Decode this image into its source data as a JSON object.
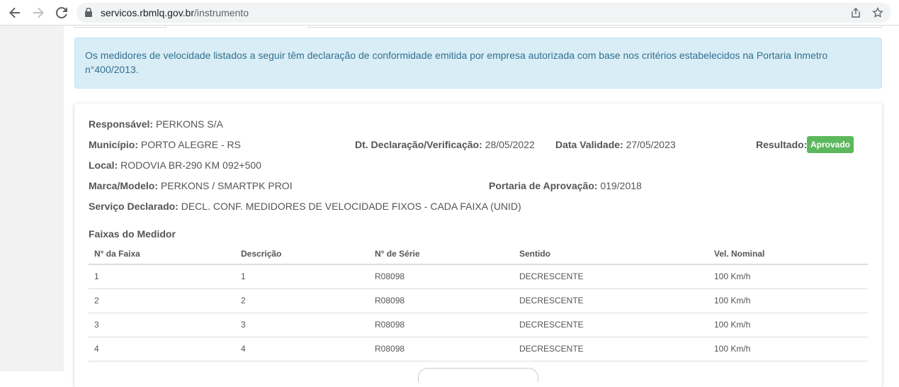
{
  "browser": {
    "url_host": "servicos.rbmlq.gov.br",
    "url_path": "/instrumento",
    "icons": [
      "back-arrow-icon",
      "forward-arrow-icon",
      "reload-icon",
      "lock-icon",
      "share-icon",
      "star-icon"
    ]
  },
  "alert": {
    "text": "Os medidores de velocidade listados a seguir têm declaração de conformidade emitida por empresa autorizada com base nos critérios estabelecidos na Portaria Inmetro n°400/2013."
  },
  "details": {
    "responsavel_label": "Responsável:",
    "responsavel_value": "PERKONS S/A",
    "municipio_label": "Município:",
    "municipio_value": "PORTO ALEGRE - RS",
    "dt_declaracao_label": "Dt. Declaração/Verificação:",
    "dt_declaracao_value": "28/05/2022",
    "data_validade_label": "Data Validade:",
    "data_validade_value": "27/05/2023",
    "resultado_label": "Resultado:",
    "resultado_value": "Aprovado",
    "local_label": "Local:",
    "local_value": "RODOVIA BR-290 KM 092+500",
    "marca_label": "Marca/Modelo:",
    "marca_value": "PERKONS / SMARTPK PROI",
    "portaria_label": "Portaria de Aprovação:",
    "portaria_value": "019/2018",
    "servico_label": "Serviço Declarado:",
    "servico_value": "DECL. CONF. MEDIDORES DE VELOCIDADE FIXOS - CADA FAIXA (UNID)"
  },
  "colors": {
    "alert_bg": "#d9edf7",
    "alert_text": "#31708f",
    "badge_success": "#5cb85c"
  },
  "faixas": {
    "title": "Faixas do Medidor",
    "columns": [
      "N° da Faixa",
      "Descrição",
      "N° de Série",
      "Sentido",
      "Vel. Nominal"
    ],
    "rows": [
      [
        "1",
        "1",
        "R08098",
        "DECRESCENTE",
        "100 Km/h"
      ],
      [
        "2",
        "2",
        "R08098",
        "DECRESCENTE",
        "100 Km/h"
      ],
      [
        "3",
        "3",
        "R08098",
        "DECRESCENTE",
        "100 Km/h"
      ],
      [
        "4",
        "4",
        "R08098",
        "DECRESCENTE",
        "100 Km/h"
      ]
    ]
  }
}
